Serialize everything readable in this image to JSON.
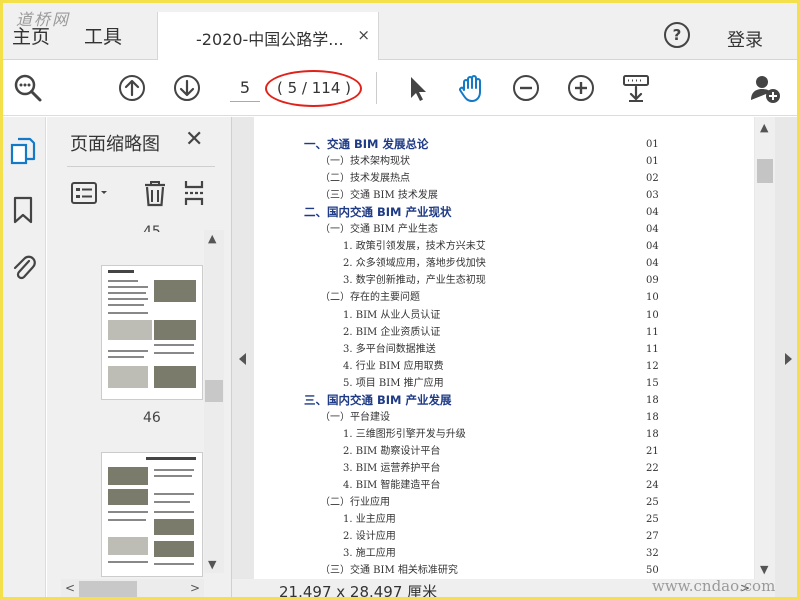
{
  "tabbar": {
    "home_label": "主页",
    "tools_label": "工具",
    "doc_tab_title": "-2020-中国公路学...",
    "doc_tab_close": "×",
    "login_label": "登录",
    "help_glyph": "?",
    "watermark": "道桥网"
  },
  "toolbar": {
    "current_page": "5",
    "page_count": "( 5 / 114 )",
    "icons": [
      "search-zoom-icon",
      "prev-page-icon",
      "next-page-icon",
      "select-cursor-icon",
      "hand-tool-icon",
      "zoom-out-icon",
      "zoom-in-icon",
      "keyboard-scroll-icon",
      "add-user-icon"
    ]
  },
  "sidebar": {
    "rail_icons": [
      "page-thumbnails-icon",
      "bookmark-icon",
      "attachment-icon"
    ],
    "panel_title": "页面缩略图",
    "panel_close": "✕",
    "pages": [
      "45",
      "46"
    ]
  },
  "document": {
    "page_size": "21.497 x 28.497 厘米",
    "watermark": "www.cndao.com",
    "toc": [
      {
        "text": "一、交通 BIM 发展总论",
        "page": "01",
        "level": 1
      },
      {
        "text": "（一）技术架构现状",
        "page": "01",
        "level": 2
      },
      {
        "text": "（二）技术发展热点",
        "page": "02",
        "level": 2
      },
      {
        "text": "（三）交通 BIM 技术发展",
        "page": "03",
        "level": 2
      },
      {
        "text": "二、国内交通 BIM 产业现状",
        "page": "04",
        "level": 1
      },
      {
        "text": "（一）交通 BIM 产业生态",
        "page": "04",
        "level": 2
      },
      {
        "text": "1. 政策引领发展，技术方兴未艾",
        "page": "04",
        "level": 3
      },
      {
        "text": "2. 众多领域应用，落地步伐加快",
        "page": "04",
        "level": 3
      },
      {
        "text": "3. 数字创新推动，产业生态初现",
        "page": "09",
        "level": 3
      },
      {
        "text": "（二）存在的主要问题",
        "page": "10",
        "level": 2
      },
      {
        "text": "1. BIM 从业人员认证",
        "page": "10",
        "level": 3
      },
      {
        "text": "2. BIM 企业资质认证",
        "page": "11",
        "level": 3
      },
      {
        "text": "3. 多平台间数据推送",
        "page": "11",
        "level": 3
      },
      {
        "text": "4. 行业 BIM 应用取费",
        "page": "12",
        "level": 3
      },
      {
        "text": "5. 项目 BIM 推广应用",
        "page": "15",
        "level": 3
      },
      {
        "text": "三、国内交通 BIM 产业发展",
        "page": "18",
        "level": 1
      },
      {
        "text": "（一）平台建设",
        "page": "18",
        "level": 2
      },
      {
        "text": "1. 三维图形引擎开发与升级",
        "page": "18",
        "level": 3
      },
      {
        "text": "2. BIM 勘察设计平台",
        "page": "21",
        "level": 3
      },
      {
        "text": "3. BIM 运营养护平台",
        "page": "22",
        "level": 3
      },
      {
        "text": "4. BIM 智能建造平台",
        "page": "24",
        "level": 3
      },
      {
        "text": "（二）行业应用",
        "page": "25",
        "level": 2
      },
      {
        "text": "1. 业主应用",
        "page": "25",
        "level": 3
      },
      {
        "text": "2. 设计应用",
        "page": "27",
        "level": 3
      },
      {
        "text": "3. 施工应用",
        "page": "32",
        "level": 3
      },
      {
        "text": "（三）交通 BIM 相关标准研究",
        "page": "50",
        "level": 2
      }
    ]
  },
  "colors": {
    "accent_blue": "#1f3b86",
    "highlight_red": "#e0221a",
    "frame_yellow": "#f4e04a"
  }
}
